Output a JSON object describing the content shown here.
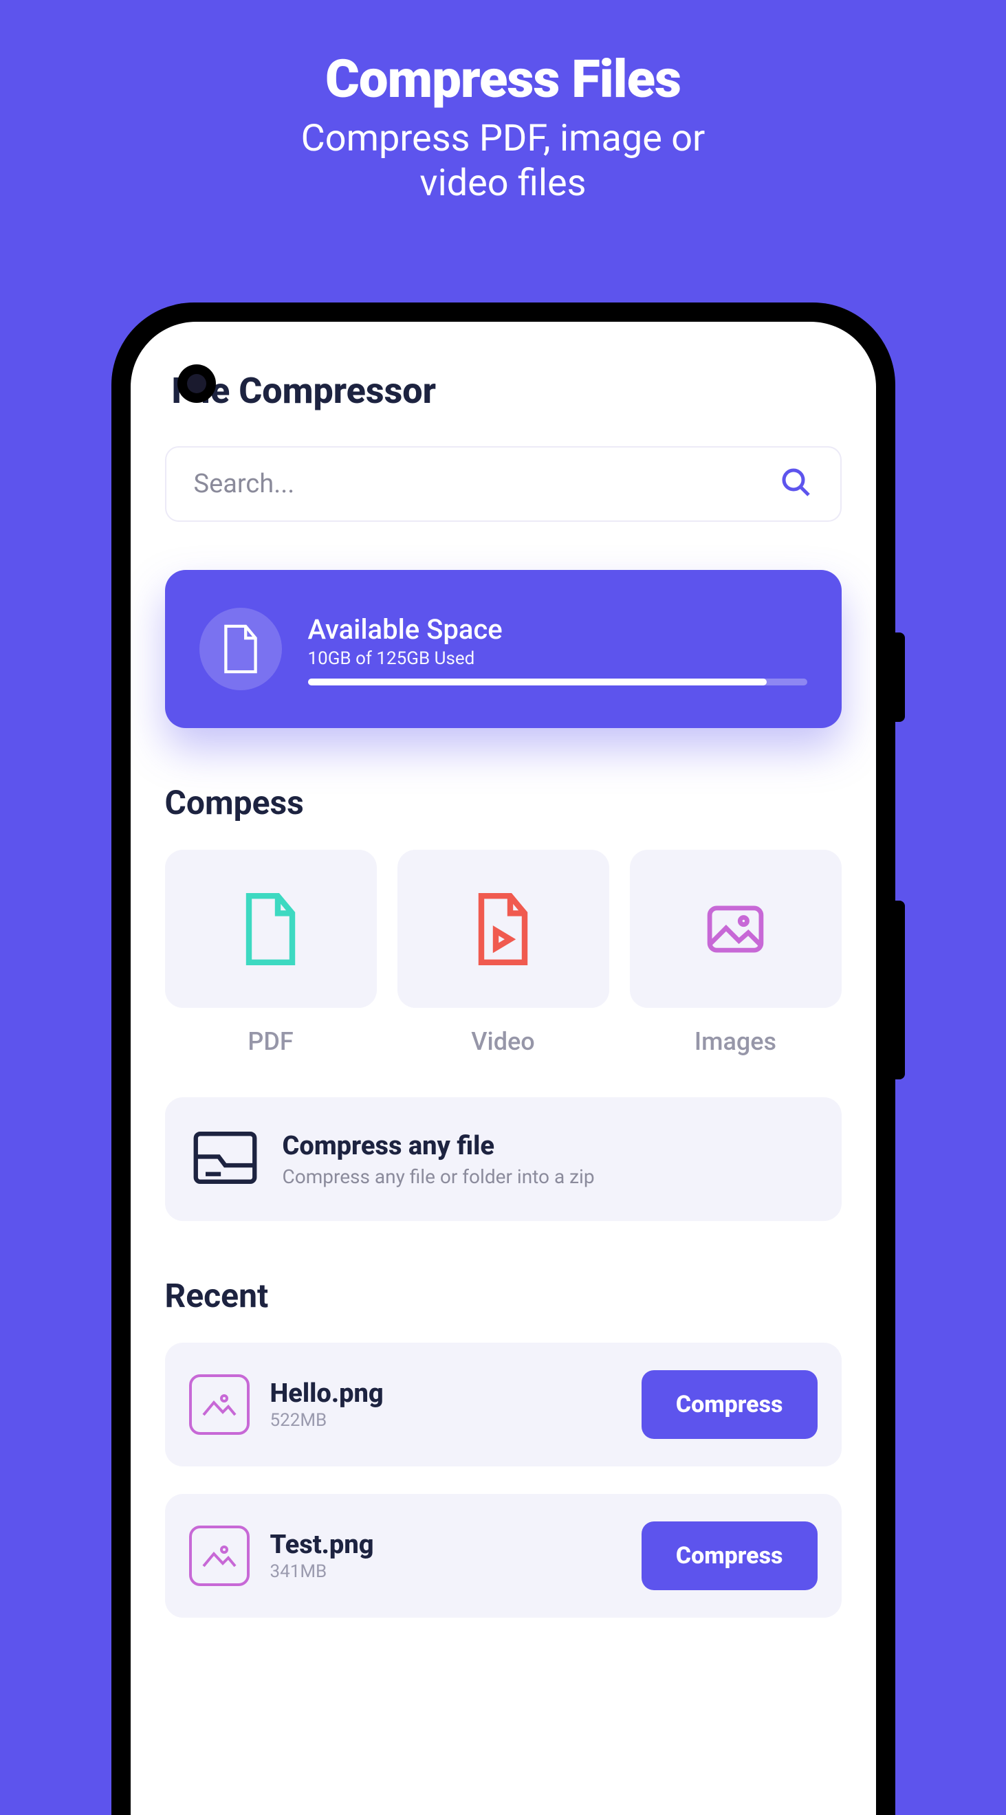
{
  "hero": {
    "title": "Compress Files",
    "subtitle_line1": "Compress PDF, image or",
    "subtitle_line2": "video files"
  },
  "app": {
    "title": "File Compressor"
  },
  "search": {
    "placeholder": "Search..."
  },
  "storage": {
    "title": "Available Space",
    "subtitle": "10GB of 125GB Used"
  },
  "sections": {
    "compress": "Compess",
    "recent": "Recent"
  },
  "tiles": {
    "pdf": "PDF",
    "video": "Video",
    "images": "Images"
  },
  "anyfile": {
    "title": "Compress any file",
    "subtitle": "Compress any file or folder into a zip"
  },
  "recent": [
    {
      "name": "Hello.png",
      "size": "522MB",
      "button": "Compress"
    },
    {
      "name": "Test.png",
      "size": "341MB",
      "button": "Compress"
    }
  ]
}
